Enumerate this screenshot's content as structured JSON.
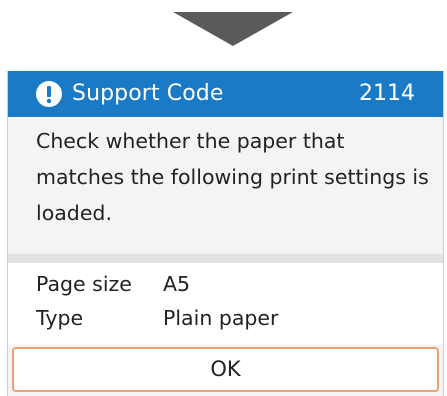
{
  "header": {
    "icon": "exclamation-icon",
    "title": "Support Code",
    "code": "2114",
    "bg_color": "#1a7ac6"
  },
  "message": "Check whether the paper that matches the following print settings is loaded.",
  "settings": [
    {
      "label": "Page size",
      "value": "A5"
    },
    {
      "label": "Type",
      "value": "Plain paper"
    }
  ],
  "ok_button": {
    "label": "OK",
    "border_color": "#f0a070"
  },
  "arrow": {
    "icon": "down-arrow-icon",
    "color": "#5a5a5a"
  }
}
